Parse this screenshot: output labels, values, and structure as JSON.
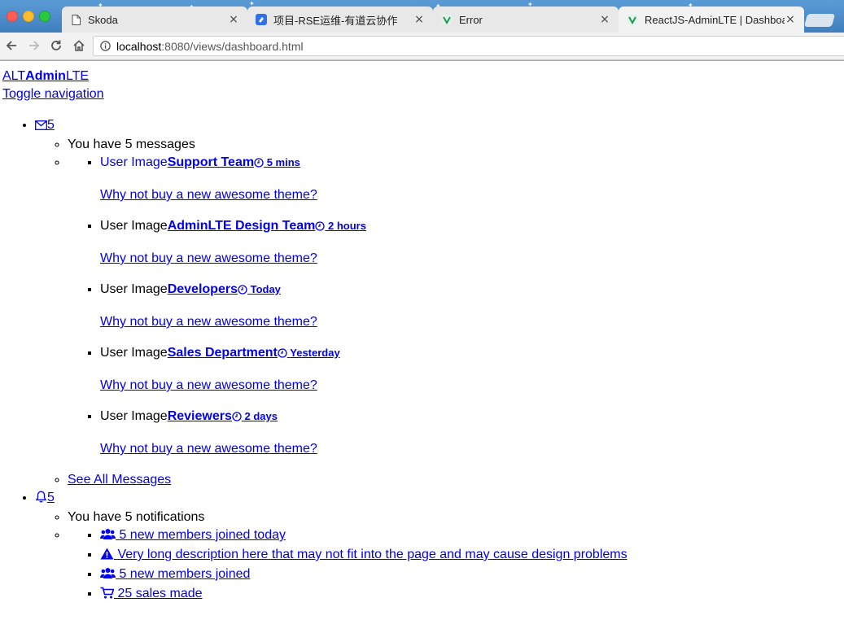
{
  "browser": {
    "tabs": [
      {
        "title": "Skoda",
        "active": false,
        "icon": "page-icon"
      },
      {
        "title": "项目-RSE运维-有道云协作",
        "active": false,
        "icon": "youdao-icon"
      },
      {
        "title": "Error",
        "active": false,
        "icon": "react-icon"
      },
      {
        "title": "ReactJS-AdminLTE | Dashboard",
        "active": true,
        "icon": "react-icon"
      }
    ],
    "close_glyph": "×",
    "url_host": "localhost",
    "url_rest": ":8080/views/dashboard.html"
  },
  "page": {
    "logo": {
      "alt": "ALT",
      "bold": "Admin",
      "tail": "LTE"
    },
    "toggle": "Toggle navigation",
    "messages": {
      "count": "5",
      "header": "You have 5 messages",
      "image_alt": "User Image",
      "items": [
        {
          "from": "Support Team",
          "time": "5 mins",
          "text": "Why not buy a new awesome theme?"
        },
        {
          "from": "AdminLTE Design Team",
          "time": "2 hours",
          "text": "Why not buy a new awesome theme?"
        },
        {
          "from": "Developers",
          "time": "Today",
          "text": "Why not buy a new awesome theme?"
        },
        {
          "from": "Sales Department",
          "time": "Yesterday",
          "text": "Why not buy a new awesome theme?"
        },
        {
          "from": "Reviewers",
          "time": "2 days",
          "text": "Why not buy a new awesome theme?"
        }
      ],
      "footer": "See All Messages"
    },
    "notifications": {
      "count": "5",
      "header": "You have 5 notifications",
      "items": [
        {
          "icon": "users-icon",
          "text": " 5 new members joined today"
        },
        {
          "icon": "warning-icon",
          "text": " Very long description here that may not fit into the page and may cause design problems"
        },
        {
          "icon": "users-icon",
          "text": " 5 new members joined"
        },
        {
          "icon": "cart-icon",
          "text": " 25 sales made"
        }
      ]
    }
  }
}
